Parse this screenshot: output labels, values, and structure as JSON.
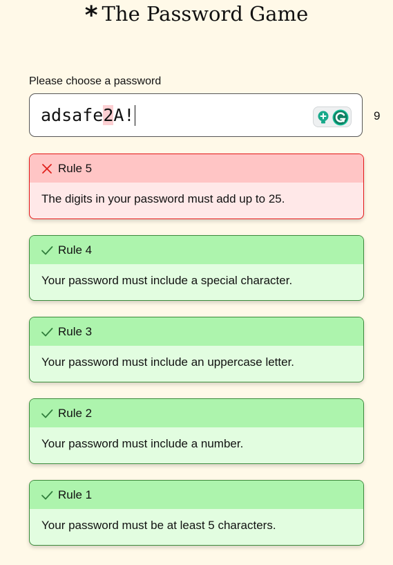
{
  "header": {
    "star": "*",
    "title": "The Password Game"
  },
  "password": {
    "label": "Please choose a password",
    "before_highlight": "adsafe",
    "highlight": "2",
    "after_highlight": "A!",
    "length": "9"
  },
  "rules": [
    {
      "title": "Rule 5",
      "text": "The digits in your password must add up to 25.",
      "status": "failed"
    },
    {
      "title": "Rule 4",
      "text": "Your password must include a special character.",
      "status": "passed"
    },
    {
      "title": "Rule 3",
      "text": "Your password must include an uppercase letter.",
      "status": "passed"
    },
    {
      "title": "Rule 2",
      "text": "Your password must include a number.",
      "status": "passed"
    },
    {
      "title": "Rule 1",
      "text": "Your password must be at least 5 characters.",
      "status": "passed"
    }
  ],
  "icons": {
    "failed": "x-icon",
    "passed": "check-icon",
    "extension_1": "lightbulb-icon",
    "extension_2": "grammarly-icon"
  },
  "colors": {
    "background": "#fff9e8",
    "pass_header": "#adf4ad",
    "pass_body": "#e2fde0",
    "pass_border": "#3b8a3b",
    "fail_header": "#ffc5c5",
    "fail_body": "#ffe8e8",
    "fail_border": "#e51616",
    "digit_highlight": "#fccfd2"
  }
}
